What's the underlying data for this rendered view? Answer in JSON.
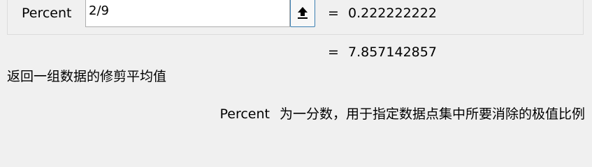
{
  "argument": {
    "label": "Percent",
    "input_value": "2/9",
    "equals": "=",
    "evaluated": "0.222222222"
  },
  "result": {
    "equals": "=",
    "value": "7.857142857"
  },
  "function_description": "返回一组数据的修剪平均值",
  "argument_help": {
    "name": "Percent",
    "text": "为一分数，用于指定数据点集中所要消除的极值比例"
  },
  "icons": {
    "collapse": "collapse-dialog-icon"
  }
}
